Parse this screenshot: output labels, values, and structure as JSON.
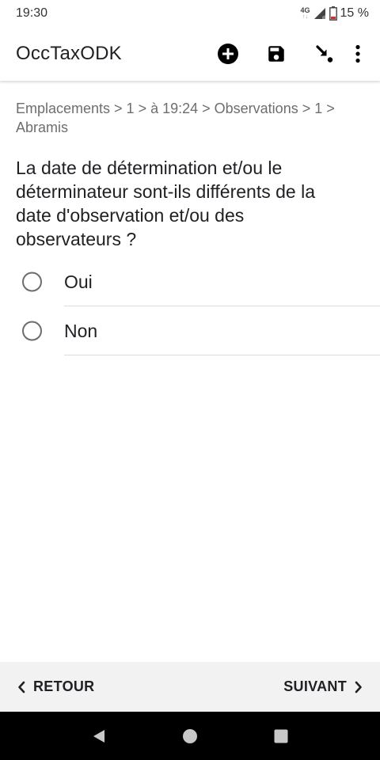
{
  "status_bar": {
    "time": "19:30",
    "network": "4G",
    "battery": "15 %"
  },
  "app_bar": {
    "title": "OccTaxODK",
    "actions": [
      {
        "name": "add-repeat-button",
        "icon": "plus-circle-icon"
      },
      {
        "name": "save-button",
        "icon": "save-icon"
      },
      {
        "name": "go-to-button",
        "icon": "jump-to-icon"
      },
      {
        "name": "more-options-button",
        "icon": "more-vert-icon"
      }
    ]
  },
  "form": {
    "breadcrumb": "Emplacements > 1 > à 19:24 > Observations > 1 > Abramis",
    "question": "La date de détermination et/ou le déterminateur sont-ils différents de la date d'observation et/ou des observateurs ?",
    "choices": [
      {
        "label": "Oui",
        "selected": false
      },
      {
        "label": "Non",
        "selected": false
      }
    ]
  },
  "navigation": {
    "back_label": "RETOUR",
    "next_label": "SUIVANT"
  },
  "colors": {
    "text": "#202124",
    "breadcrumb": "#6e6e6e",
    "radio_border": "#6d6d6d",
    "nav_background": "#f2f2f2",
    "battery_low": "#d32f2f"
  }
}
